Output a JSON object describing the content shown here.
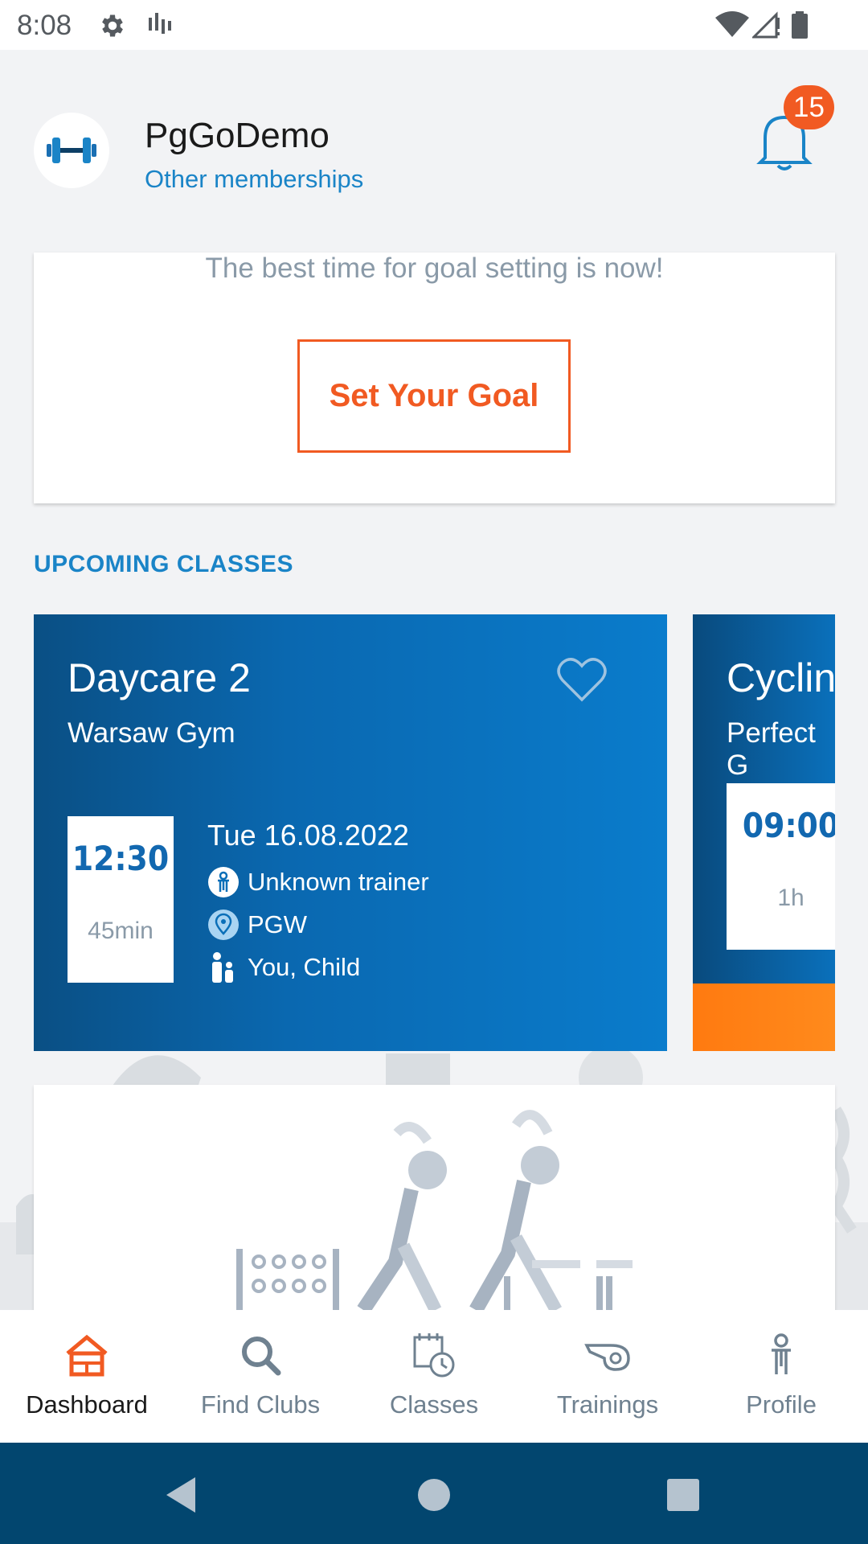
{
  "status_bar": {
    "time": "8:08",
    "icons": [
      "gear-icon",
      "signal-bars-icon",
      "wifi-icon",
      "cellular-icon",
      "battery-icon"
    ]
  },
  "header": {
    "club_name": "PgGoDemo",
    "other_memberships": "Other memberships",
    "notifications_count": "15",
    "avatar_icon": "dumbbell-icon",
    "bell_icon": "bell-icon"
  },
  "goal_card": {
    "text": "The best time for goal setting is now!",
    "button_label": "Set Your Goal"
  },
  "upcoming": {
    "section_title": "UPCOMING CLASSES",
    "classes": [
      {
        "title": "Daycare 2",
        "location": "Warsaw Gym",
        "time": "12:30",
        "duration": "45min",
        "date": "Tue 16.08.2022",
        "trainer": "Unknown trainer",
        "place": "PGW",
        "participants": "You, Child"
      },
      {
        "title": "Cyclin",
        "location": "Perfect G",
        "time": "09:00",
        "duration": "1h"
      }
    ]
  },
  "bottom_nav": {
    "items": [
      {
        "label": "Dashboard",
        "icon": "home-icon"
      },
      {
        "label": "Find Clubs",
        "icon": "search-icon"
      },
      {
        "label": "Classes",
        "icon": "calendar-clock-icon"
      },
      {
        "label": "Trainings",
        "icon": "whistle-icon"
      },
      {
        "label": "Profile",
        "icon": "person-icon"
      }
    ]
  },
  "colors": {
    "accent_orange": "#f15a22",
    "link_blue": "#1a84c7",
    "card_blue": "#0a7ccc",
    "system_nav": "#02466f"
  }
}
